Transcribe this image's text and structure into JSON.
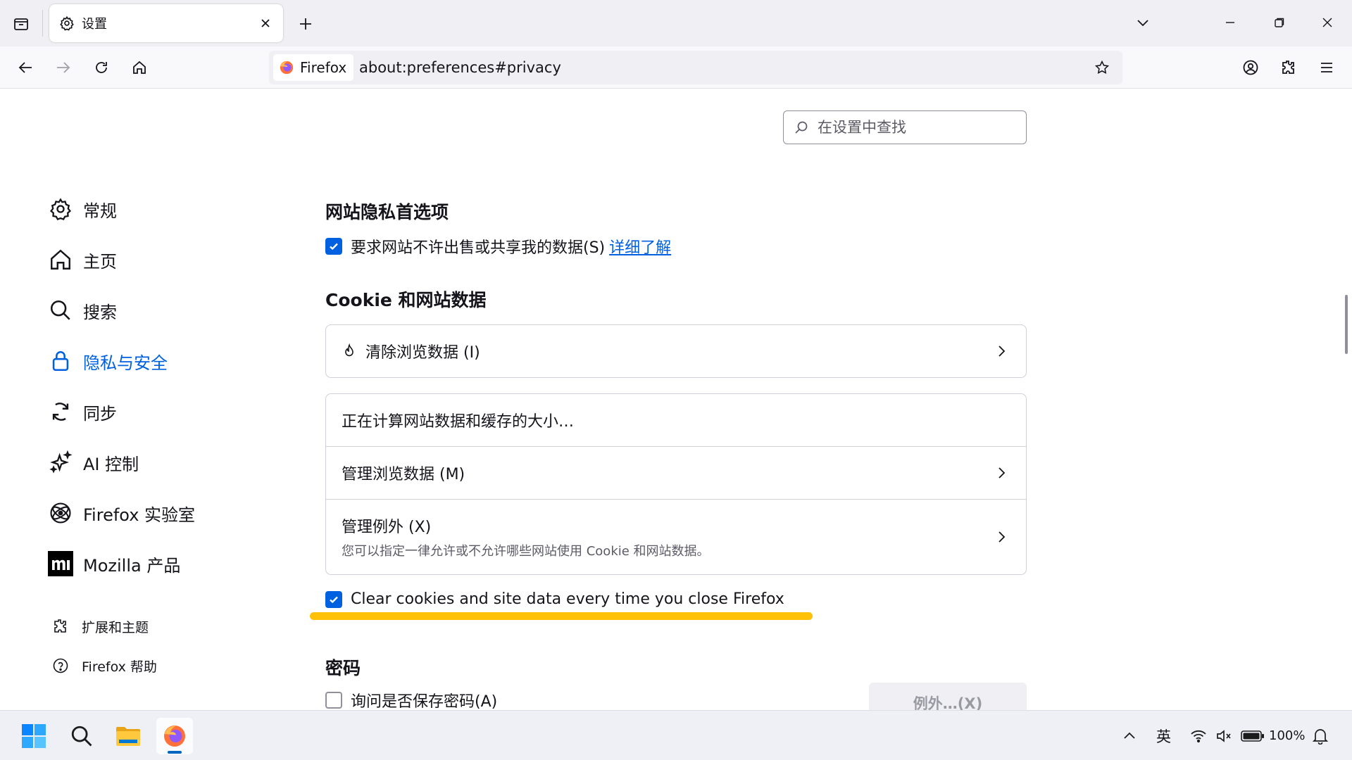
{
  "browser": {
    "tab": {
      "title": "设置"
    },
    "identity_label": "Firefox",
    "url": "about:preferences#privacy"
  },
  "search": {
    "placeholder": "在设置中查找"
  },
  "sidebar": {
    "categories": [
      {
        "label": "常规",
        "icon": "gear-icon"
      },
      {
        "label": "主页",
        "icon": "home-icon"
      },
      {
        "label": "搜索",
        "icon": "search-icon"
      },
      {
        "label": "隐私与安全",
        "icon": "lock-icon",
        "selected": true
      },
      {
        "label": "同步",
        "icon": "sync-icon"
      },
      {
        "label": "AI 控制",
        "icon": "sparkle-icon"
      },
      {
        "label": "Firefox 实验室",
        "icon": "labs-icon"
      },
      {
        "label": "Mozilla 产品",
        "icon": "mozilla-icon"
      }
    ],
    "footer": [
      {
        "label": "扩展和主题",
        "icon": "puzzle-icon"
      },
      {
        "label": "Firefox 帮助",
        "icon": "help-icon"
      }
    ]
  },
  "privacy": {
    "website_pref_heading": "网站隐私首选项",
    "gpc_label": "要求网站不许出售或共享我的数据(S)",
    "gpc_checked": true,
    "learn_more": "详细了解",
    "cookies_heading": "Cookie 和网站数据",
    "clear_data_label": "清除浏览数据 (I)",
    "calculating": "正在计算网站数据和缓存的大小…",
    "manage_data_label": "管理浏览数据 (M)",
    "manage_exceptions_label": "管理例外 (X)",
    "manage_exceptions_desc": "您可以指定一律允许或不允许哪些网站使用 Cookie 和网站数据。",
    "clear_on_close_label": "Clear cookies and site data every time you close Firefox",
    "clear_on_close_checked": true,
    "passwords_heading": "密码",
    "ask_save_passwords_label": "询问是否保存密码(A)",
    "ask_save_passwords_checked": false,
    "exceptions_button": "例外…(X)"
  },
  "taskbar": {
    "ime": "英",
    "battery": "100%"
  },
  "colors": {
    "accent": "#0061e0",
    "highlight": "#ffc107"
  }
}
